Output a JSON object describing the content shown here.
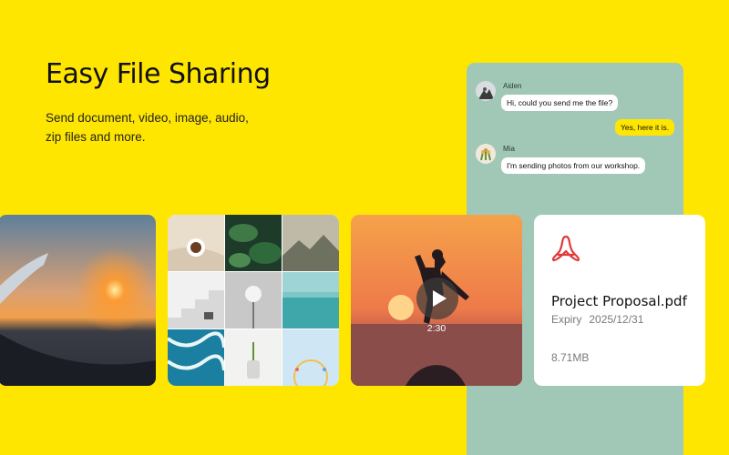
{
  "hero": {
    "title": "Easy File Sharing",
    "subtitle_line1": "Send document, video, image, audio,",
    "subtitle_line2": "zip files and more."
  },
  "chat": {
    "messages": [
      {
        "sender": "Aiden",
        "text": "Hi, could you send me the file?"
      },
      {
        "sender": "",
        "text": "Yes, here it is."
      },
      {
        "sender": "Mia",
        "text": "I'm sending photos from our workshop."
      }
    ]
  },
  "video": {
    "duration": "2:30",
    "icon": "play-icon"
  },
  "file": {
    "name": "Project Proposal.pdf",
    "expiry_label": "Expiry",
    "expiry_date": "2025/12/31",
    "size": "8.71MB",
    "icon": "pdf-icon"
  },
  "colors": {
    "background": "#ffe600",
    "chat_panel": "#a1c8b6",
    "pdf_icon": "#e23a3a"
  }
}
